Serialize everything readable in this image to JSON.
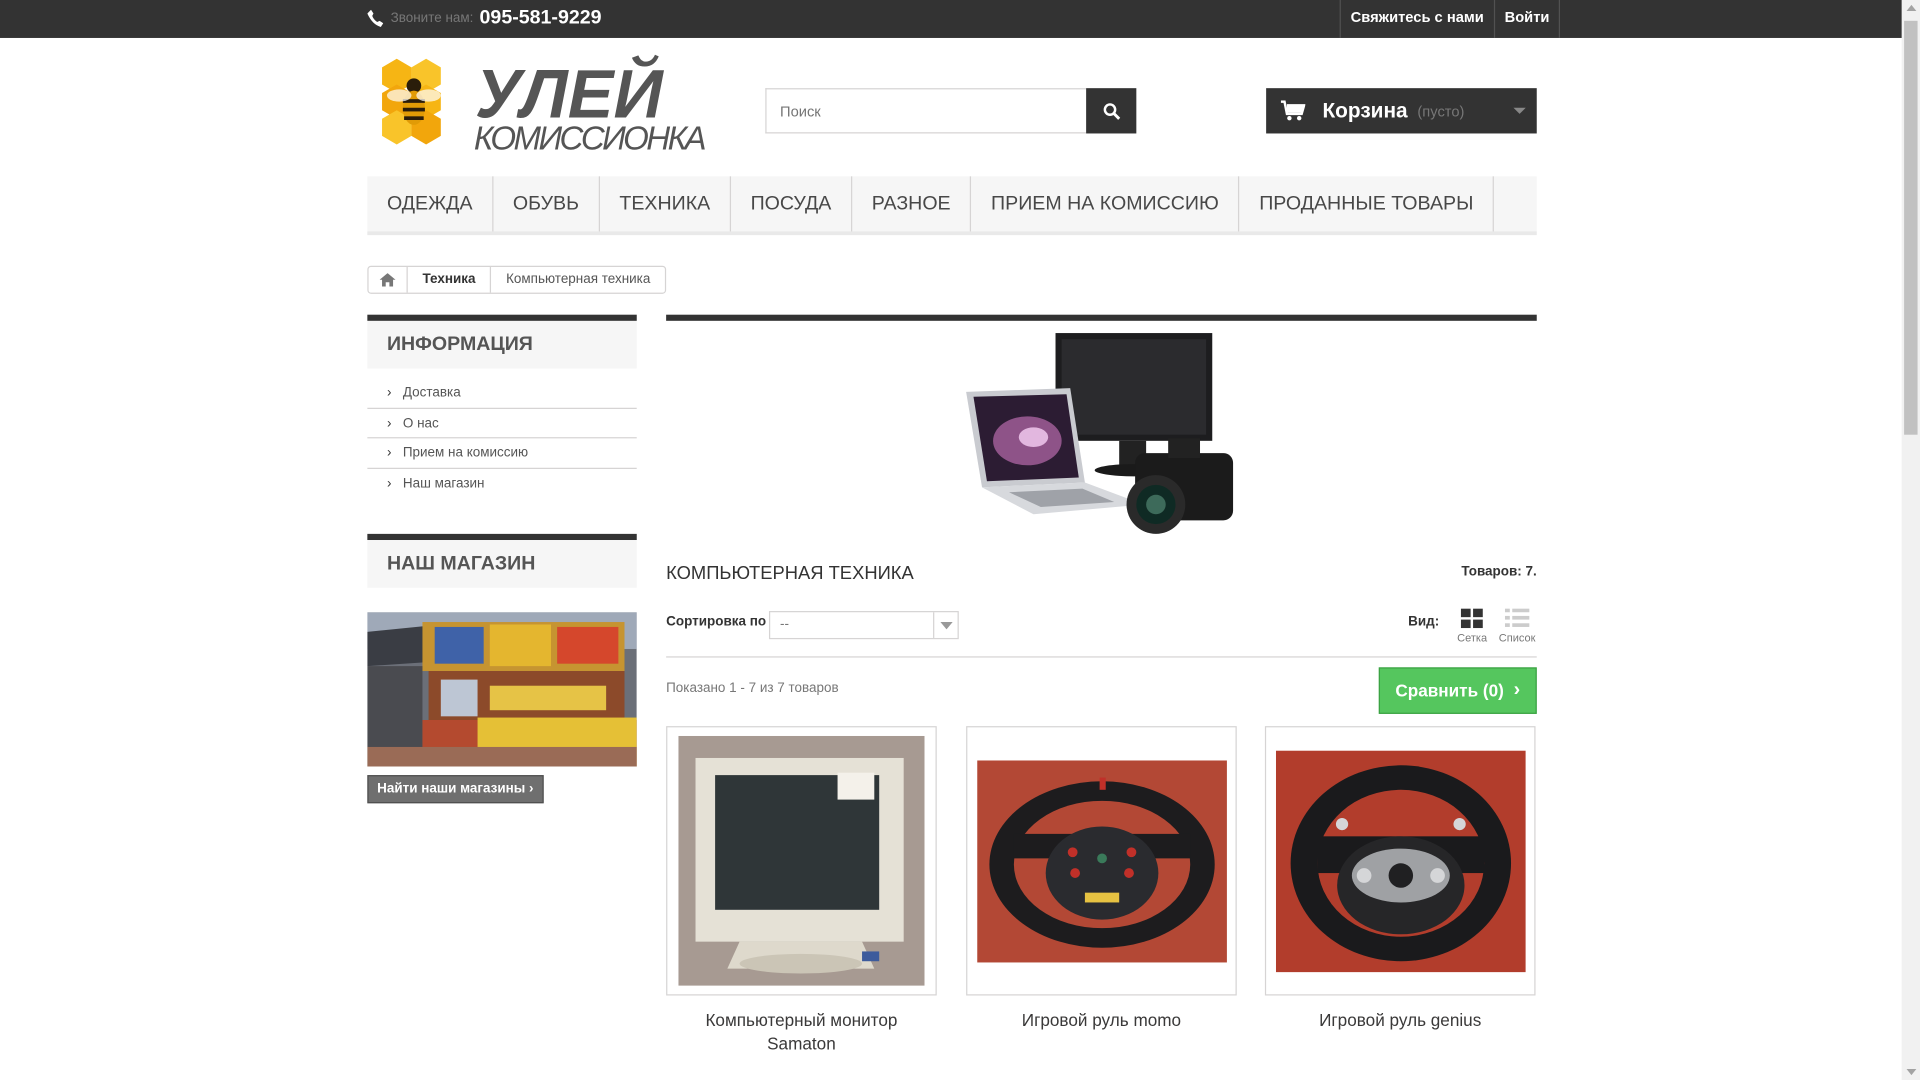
{
  "header": {
    "call_label": "Звоните нам:",
    "phone": "095-581-9229",
    "contact_link": "Свяжитесь с нами",
    "login_link": "Войти",
    "logo_alt": "УЛЕЙ КОМИССИОНКА"
  },
  "search": {
    "placeholder": "Поиск",
    "icon": "search-icon"
  },
  "cart": {
    "title": "Корзина",
    "status": "(пусто)",
    "icon": "shopping-cart-icon"
  },
  "menu": {
    "items": [
      "ОДЕЖДА",
      "ОБУВЬ",
      "ТЕХНИКА",
      "ПОСУДА",
      "РАЗНОЕ",
      "ПРИЕМ НА КОМИССИЮ",
      "ПРОДАННЫЕ ТОВАРЫ"
    ]
  },
  "breadcrumb": {
    "home_icon": "home-icon",
    "items": [
      "Техника",
      "Компьютерная техника"
    ]
  },
  "sidebar": {
    "info_title": "ИНФОРМАЦИЯ",
    "info_items": [
      "Доставка",
      "О нас",
      "Прием на комиссию",
      "Наш магазин"
    ],
    "store_title": "НАШ МАГАЗИН",
    "store_button": "Найти наши магазины"
  },
  "category": {
    "title": "КОМПЬЮТЕРНАЯ ТЕХНИКА",
    "count": "Товаров: 7.",
    "sort_label": "Сортировка по",
    "sort_value": "--",
    "view_label": "Вид:",
    "view_grid": "Сетка",
    "view_list": "Список",
    "shown": "Показано 1 - 7 из 7 товаров",
    "compare": "Сравнить (0)"
  },
  "products": [
    {
      "name": "Компьютерный монитор Samaton",
      "price": ""
    },
    {
      "name": "Игровой руль momo",
      "price": ""
    },
    {
      "name": "Игровой руль genius",
      "price": ""
    }
  ],
  "colors": {
    "topbar": "#333333",
    "compare_green": "#55c65e",
    "menu_bg": "#f6f6f6"
  }
}
